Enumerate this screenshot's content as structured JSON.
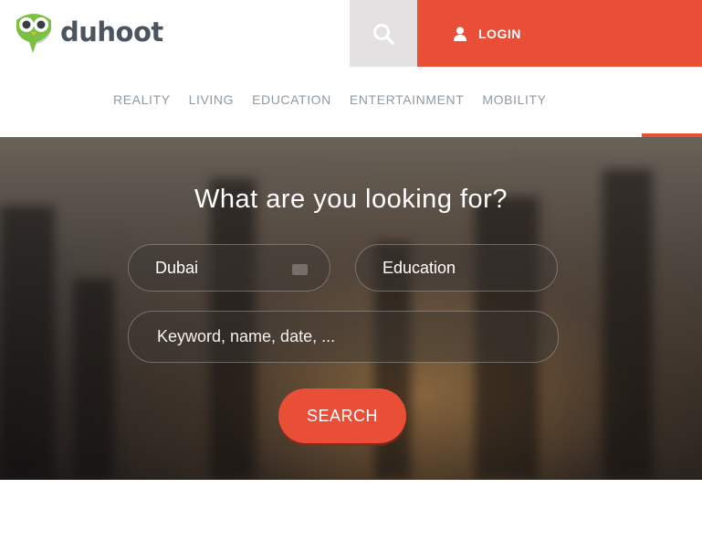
{
  "brand": {
    "name": "duhoot",
    "accent": "#e94f37"
  },
  "header": {
    "search_icon": "search-icon",
    "login_label": "LOGIN",
    "login_icon": "user-icon"
  },
  "nav": {
    "items": [
      "REALITY",
      "LIVING",
      "EDUCATION",
      "ENTERTAINMENT",
      "MOBILITY"
    ]
  },
  "hero": {
    "title": "What are you looking for?",
    "city_value": "Dubai",
    "category_value": "Education",
    "keyword_placeholder": "Keyword, name, date, ...",
    "search_label": "SEARCH"
  }
}
